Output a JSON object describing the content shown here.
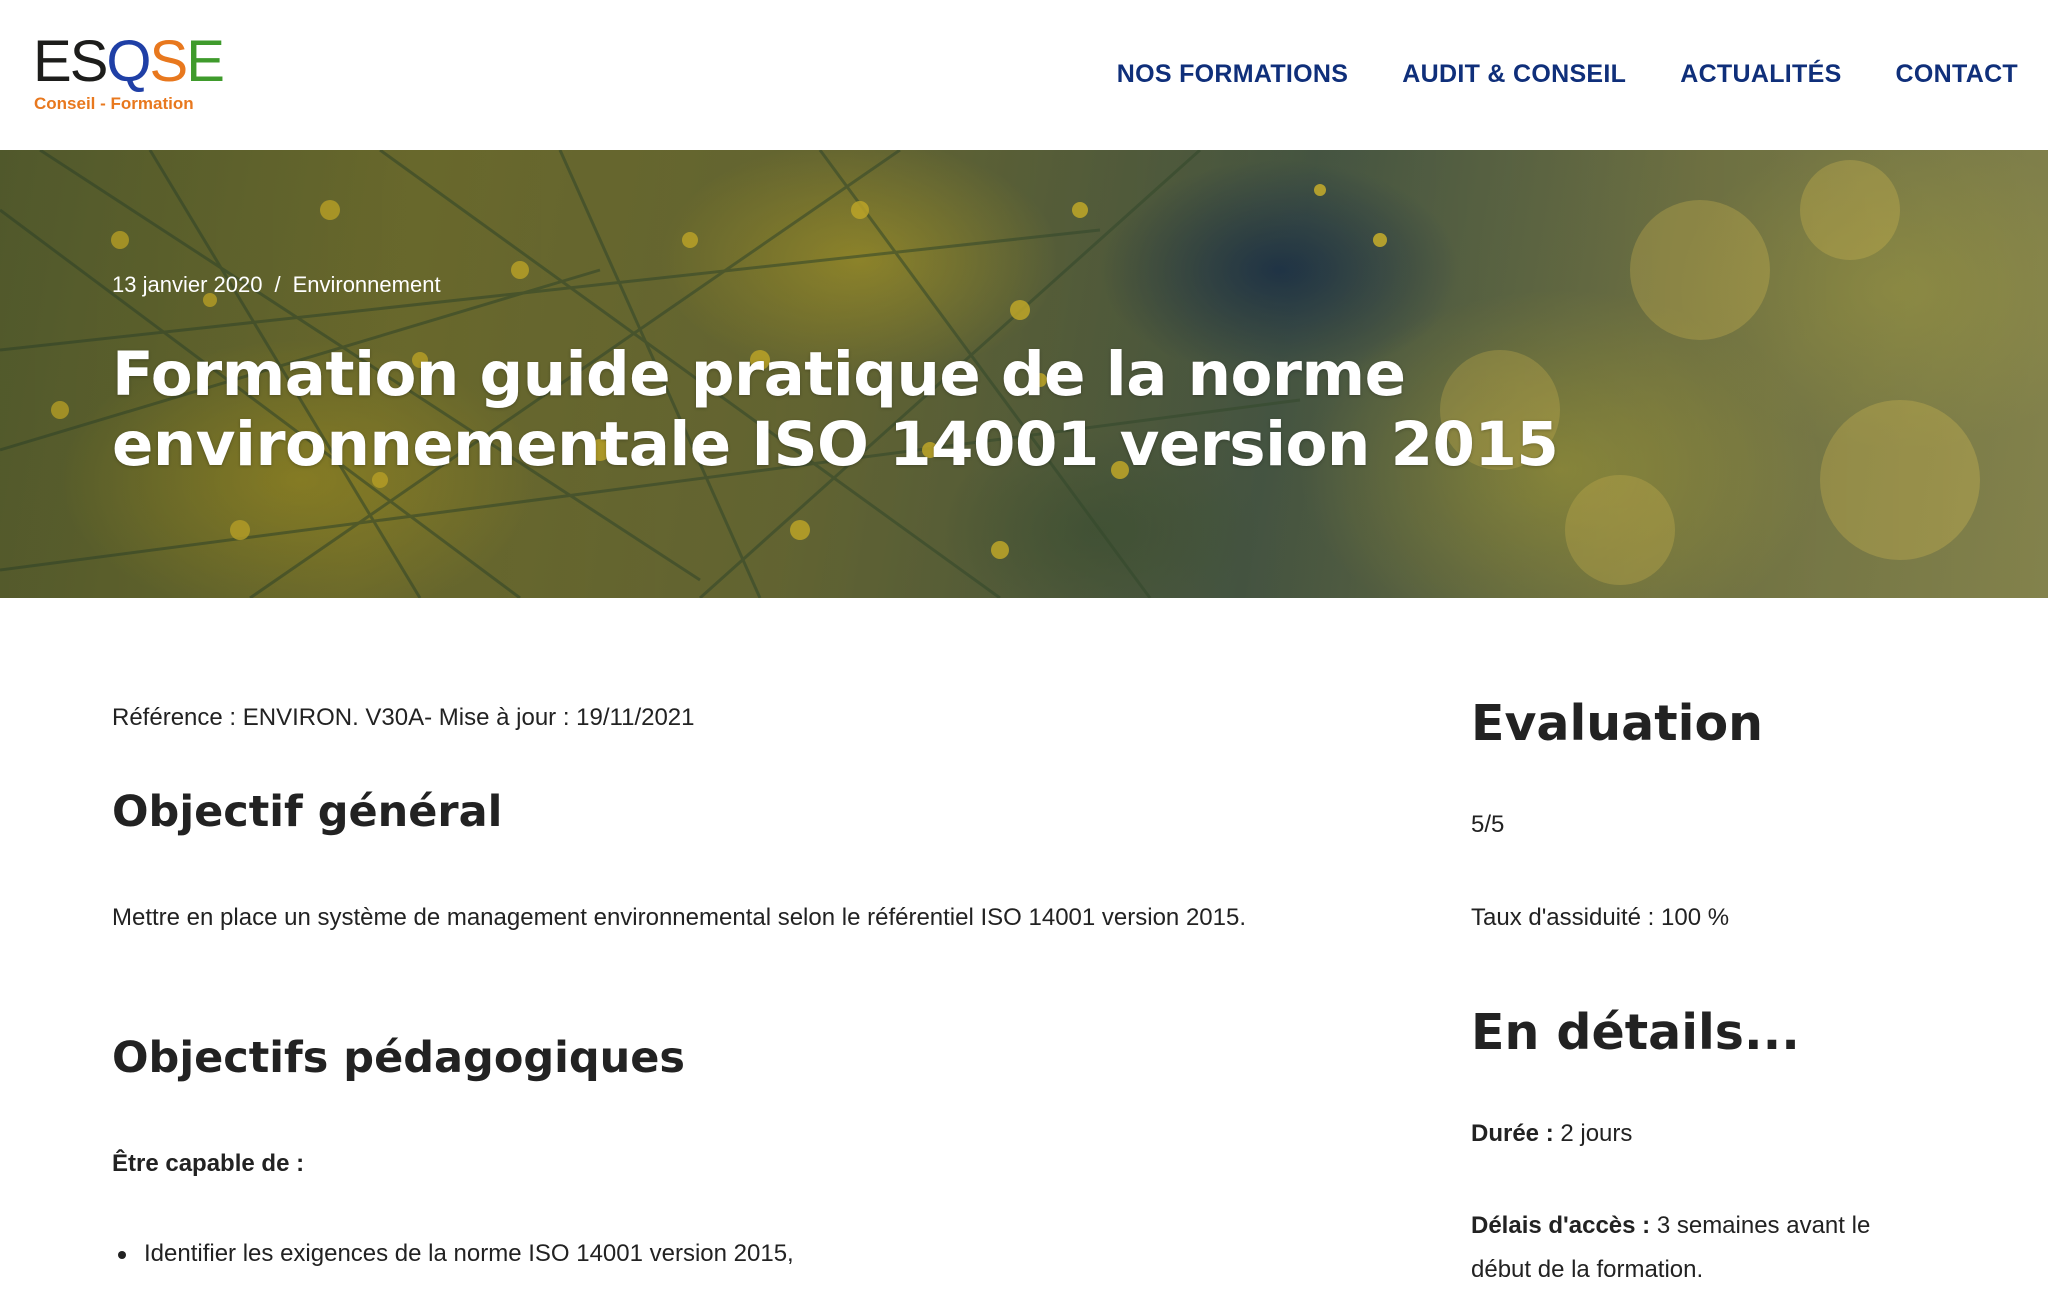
{
  "brand": {
    "letters": [
      {
        "char": "E",
        "color": "#1d1d1b"
      },
      {
        "char": "S",
        "color": "#1d1d1b"
      },
      {
        "char": "Q",
        "color": "#1f3fa6"
      },
      {
        "char": "S",
        "color": "#e8781e"
      },
      {
        "char": "E",
        "color": "#3f9b2c"
      }
    ],
    "tagline": "Conseil - Formation",
    "tagline_color": "#e8781e"
  },
  "nav": {
    "color": "#0f2f7a",
    "items": [
      {
        "label": "NOS FORMATIONS"
      },
      {
        "label": "AUDIT & CONSEIL"
      },
      {
        "label": "ACTUALITÉS"
      },
      {
        "label": "CONTACT"
      }
    ]
  },
  "hero": {
    "date": "13 janvier 2020",
    "separator": "/",
    "category": "Environnement",
    "title_line1": "Formation guide pratique de la norme",
    "title_line2": "environnementale ISO 14001 version 2015"
  },
  "main": {
    "reference": "Référence : ENVIRON. V30A- Mise à jour : 19/11/2021",
    "objectif_general_heading": "Objectif général",
    "objectif_general_text": "Mettre en place un système de management environnemental selon le référentiel ISO 14001 version 2015.",
    "objectifs_pedagogiques_heading": "Objectifs pédagogiques",
    "capable_label": "Être capable de :",
    "capabilities": [
      "Identifier les exigences de la norme ISO 14001 version 2015,"
    ]
  },
  "aside": {
    "evaluation_heading": "Evaluation",
    "rating": "5/5",
    "attendance": "Taux d'assiduité : 100 %",
    "details_heading": "En détails...",
    "duration_label": "Durée :",
    "duration_value": "2 jours",
    "access_label": "Délais d'accès :",
    "access_value": "3 semaines avant le",
    "access_value_line2": "début de la formation."
  }
}
